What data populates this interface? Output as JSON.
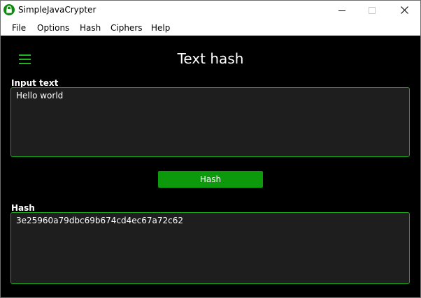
{
  "window": {
    "title": "SimpleJavaCrypter",
    "icon": "padlock-icon"
  },
  "menu": {
    "items": [
      "File",
      "Options",
      "Hash",
      "Ciphers",
      "Help"
    ]
  },
  "page": {
    "title": "Text hash",
    "input_label": "Input text",
    "input_value": "Hello world",
    "hash_button_label": "Hash",
    "output_label": "Hash",
    "output_value": "3e25960a79dbc69b674cd4ec67a72c62"
  },
  "colors": {
    "accent": "#1db41d",
    "button": "#0c9a0c",
    "background": "#000000",
    "field_background": "#1e1e1e"
  }
}
